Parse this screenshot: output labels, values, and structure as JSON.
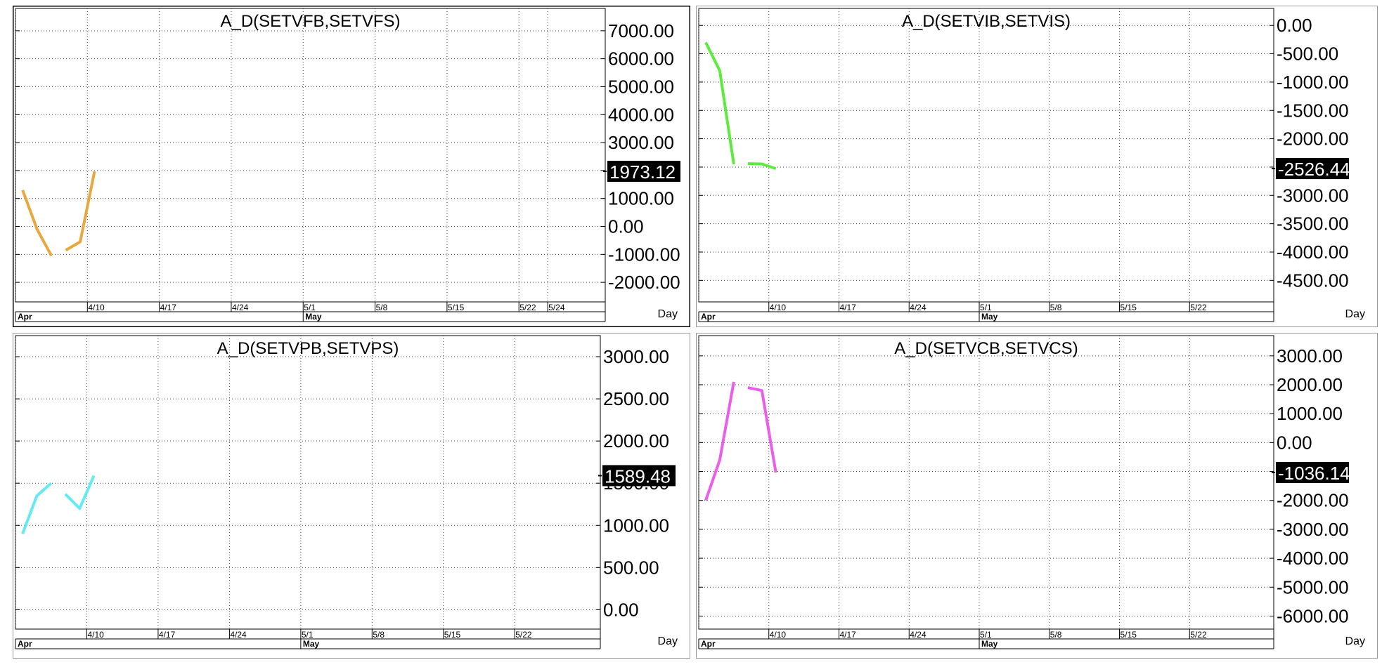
{
  "chart_data": [
    {
      "type": "line",
      "title": "A_D(SETVFB,SETVFS)",
      "color": "#E8A83E",
      "yticks": [
        7000,
        6000,
        5000,
        4000,
        3000,
        2000,
        1000,
        0,
        -1000,
        -2000
      ],
      "ytick_labels": [
        "7000.00",
        "6000.00",
        "5000.00",
        "4000.00",
        "3000.00",
        "2000.00",
        "1000.00",
        "0.00",
        "-1000.00",
        "-2000.00"
      ],
      "hidden_tick_index": 5,
      "ylim": [
        -2700,
        7800
      ],
      "xlim": [
        0,
        41
      ],
      "xticks": [
        {
          "label": "4/10",
          "x": 5
        },
        {
          "label": "4/17",
          "x": 10
        },
        {
          "label": "4/24",
          "x": 15
        },
        {
          "label": "5/1",
          "x": 20
        },
        {
          "label": "5/8",
          "x": 25
        },
        {
          "label": "5/15",
          "x": 30
        },
        {
          "label": "5/22",
          "x": 35
        },
        {
          "label": "5/24",
          "x": 37
        }
      ],
      "months": [
        {
          "label": "Apr",
          "x": 0
        },
        {
          "label": "May",
          "x": 20
        }
      ],
      "segments": [
        [
          {
            "x": 0.5,
            "y": 1300
          },
          {
            "x": 1.5,
            "y": -100
          },
          {
            "x": 2.5,
            "y": -1050
          }
        ],
        [
          {
            "x": 3.5,
            "y": -850
          },
          {
            "x": 4.5,
            "y": -550
          },
          {
            "x": 5.5,
            "y": 1973.12
          }
        ]
      ],
      "last_value": "1973.12",
      "unit_label": "Day"
    },
    {
      "type": "line",
      "title": "A_D(SETVIB,SETVIS)",
      "color": "#5DEB3E",
      "yticks": [
        0,
        -500,
        -1000,
        -1500,
        -2000,
        -2500,
        -3000,
        -3500,
        -4000,
        -4500
      ],
      "ytick_labels": [
        "0.00",
        "-500.00",
        "-1000.00",
        "-1500.00",
        "-2000.00",
        "-2500.00",
        "-3000.00",
        "-3500.00",
        "-4000.00",
        "-4500.00"
      ],
      "hidden_tick_index": 5,
      "ylim": [
        -4880,
        300
      ],
      "xlim": [
        0,
        41
      ],
      "xticks": [
        {
          "label": "4/10",
          "x": 5
        },
        {
          "label": "4/17",
          "x": 10
        },
        {
          "label": "4/24",
          "x": 15
        },
        {
          "label": "5/1",
          "x": 20
        },
        {
          "label": "5/8",
          "x": 25
        },
        {
          "label": "5/15",
          "x": 30
        },
        {
          "label": "5/22",
          "x": 35
        }
      ],
      "months": [
        {
          "label": "Apr",
          "x": 0
        },
        {
          "label": "May",
          "x": 20
        }
      ],
      "segments": [
        [
          {
            "x": 0.5,
            "y": -300
          },
          {
            "x": 1.5,
            "y": -800
          },
          {
            "x": 2.5,
            "y": -2450
          }
        ],
        [
          {
            "x": 3.5,
            "y": -2440
          },
          {
            "x": 4.5,
            "y": -2445
          },
          {
            "x": 5.5,
            "y": -2526.44
          }
        ]
      ],
      "last_value": "-2526.44",
      "unit_label": "Day"
    },
    {
      "type": "line",
      "title": "A_D(SETVPB,SETVPS)",
      "color": "#63EAF2",
      "yticks": [
        3000,
        2500,
        2000,
        1500,
        1000,
        500,
        0
      ],
      "ytick_labels": [
        "3000.00",
        "2500.00",
        "2000.00",
        "1500.00",
        "1000.00",
        "500.00",
        "0.00"
      ],
      "hidden_tick_index": -1,
      "ylim": [
        -230,
        3250
      ],
      "xlim": [
        0,
        41
      ],
      "xticks": [
        {
          "label": "4/10",
          "x": 5
        },
        {
          "label": "4/17",
          "x": 10
        },
        {
          "label": "4/24",
          "x": 15
        },
        {
          "label": "5/1",
          "x": 20
        },
        {
          "label": "5/8",
          "x": 25
        },
        {
          "label": "5/15",
          "x": 30
        },
        {
          "label": "5/22",
          "x": 35
        }
      ],
      "months": [
        {
          "label": "Apr",
          "x": 0
        },
        {
          "label": "May",
          "x": 20
        }
      ],
      "segments": [
        [
          {
            "x": 0.5,
            "y": 900
          },
          {
            "x": 1.5,
            "y": 1350
          },
          {
            "x": 2.5,
            "y": 1500
          }
        ],
        [
          {
            "x": 3.5,
            "y": 1370
          },
          {
            "x": 4.5,
            "y": 1200
          },
          {
            "x": 5.5,
            "y": 1589.48
          }
        ]
      ],
      "last_value": "1589.48",
      "unit_label": "Day"
    },
    {
      "type": "line",
      "title": "A_D(SETVCB,SETVCS)",
      "color": "#EA5EEA",
      "yticks": [
        3000,
        2000,
        1000,
        0,
        -1000,
        -2000,
        -3000,
        -4000,
        -5000,
        -6000
      ],
      "ytick_labels": [
        "3000.00",
        "2000.00",
        "1000.00",
        "0.00",
        "-1000.00",
        "-2000.00",
        "-3000.00",
        "-4000.00",
        "-5000.00",
        "-6000.00"
      ],
      "hidden_tick_index": 4,
      "ylim": [
        -6450,
        3700
      ],
      "xlim": [
        0,
        41
      ],
      "xticks": [
        {
          "label": "4/10",
          "x": 5
        },
        {
          "label": "4/17",
          "x": 10
        },
        {
          "label": "4/24",
          "x": 15
        },
        {
          "label": "5/1",
          "x": 20
        },
        {
          "label": "5/8",
          "x": 25
        },
        {
          "label": "5/15",
          "x": 30
        },
        {
          "label": "5/22",
          "x": 35
        }
      ],
      "months": [
        {
          "label": "Apr",
          "x": 0
        },
        {
          "label": "May",
          "x": 20
        }
      ],
      "segments": [
        [
          {
            "x": 0.5,
            "y": -2000
          },
          {
            "x": 1.5,
            "y": -600
          },
          {
            "x": 2.5,
            "y": 2100
          }
        ],
        [
          {
            "x": 3.5,
            "y": 1900
          },
          {
            "x": 4.5,
            "y": 1800
          },
          {
            "x": 5.5,
            "y": -1036.14
          }
        ]
      ],
      "last_value": "-1036.14",
      "unit_label": "Day"
    }
  ]
}
